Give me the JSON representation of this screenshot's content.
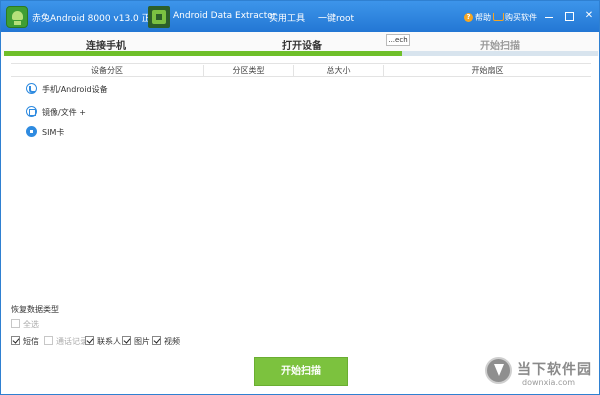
{
  "titlebar": {
    "app_title": "赤兔Android 8000 v13.0 正式版",
    "ade_title": "Android Data Extractor",
    "menu_tools": "实用工具",
    "menu_root": "一键root",
    "help_label": "帮助",
    "buy_label": "购买软件",
    "help_icon_glyph": "?",
    "icons": [
      "app-logo-icon",
      "ade-logo-icon",
      "help-icon",
      "cart-icon",
      "minimize-icon",
      "maximize-icon",
      "close-icon"
    ]
  },
  "steps": {
    "items": [
      "连接手机",
      "打开设备",
      "开始扫描"
    ],
    "active_step_count": 2,
    "progress": 0.67,
    "tooltip": "...ech"
  },
  "table": {
    "headers": [
      "设备分区",
      "分区类型",
      "总大小",
      "开始扇区"
    ]
  },
  "sources": [
    {
      "label": "手机/Android设备",
      "icon": "phone-icon"
    },
    {
      "label": "镜像/文件 +",
      "icon": "image-file-icon"
    },
    {
      "label": "SIM卡",
      "icon": "sim-card-icon"
    }
  ],
  "recovery_types": {
    "title": "恢复数据类型",
    "select_all": {
      "label": "全选",
      "checked": false,
      "disabled": true
    },
    "options": [
      {
        "label": "短信",
        "checked": true,
        "disabled": false
      },
      {
        "label": "通话记录",
        "checked": false,
        "disabled": true
      },
      {
        "label": "联系人",
        "checked": true,
        "disabled": false
      },
      {
        "label": "图片",
        "checked": true,
        "disabled": false
      },
      {
        "label": "视频",
        "checked": true,
        "disabled": false
      }
    ]
  },
  "scan_button": "开始扫描",
  "watermark": {
    "title": "当下软件园",
    "url": "downxia.com"
  },
  "colors": {
    "titlebar": "#2f85dc",
    "progress_fill": "#6fbf2a",
    "progress_track": "#d8e4ee",
    "scan_button": "#7cc23e",
    "icon_blue": "#2f8be0"
  }
}
